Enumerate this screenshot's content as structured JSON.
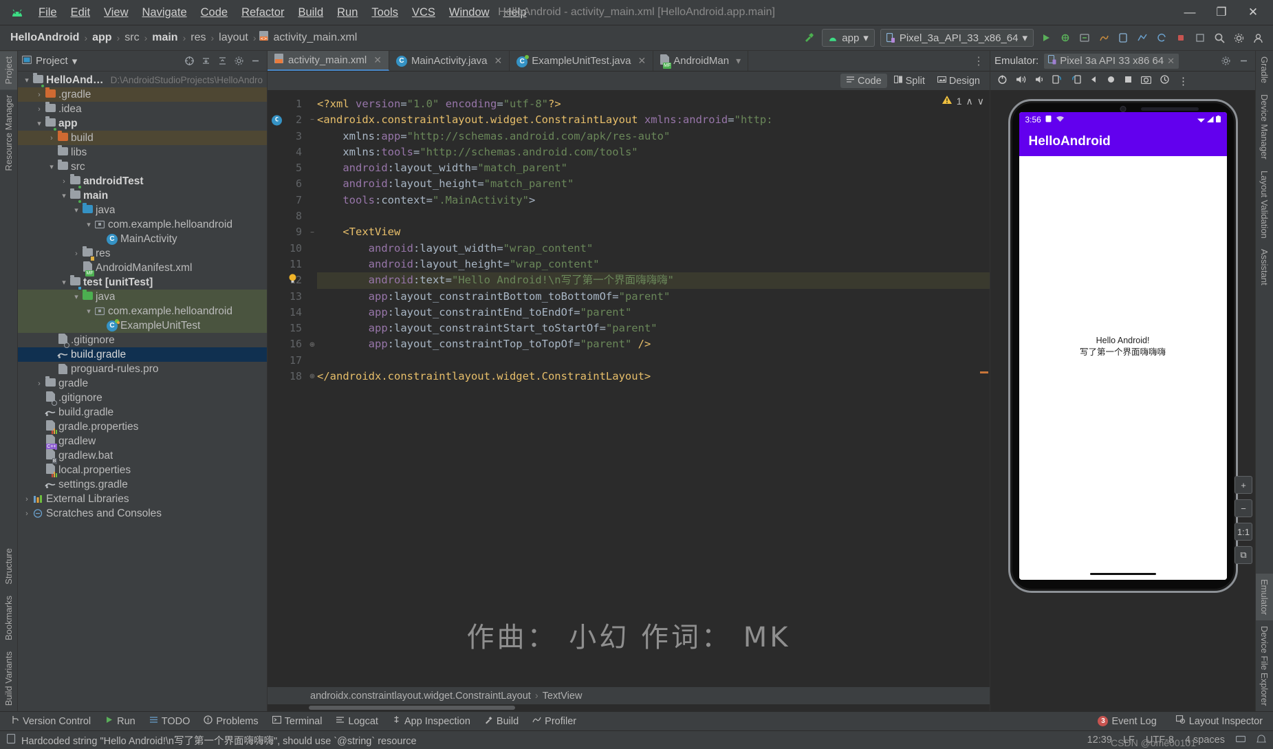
{
  "window": {
    "title": "HelloAndroid - activity_main.xml [HelloAndroid.app.main]",
    "minimize": "—",
    "maximize": "❐",
    "close": "✕"
  },
  "menubar": [
    {
      "label": "File"
    },
    {
      "label": "Edit"
    },
    {
      "label": "View"
    },
    {
      "label": "Navigate"
    },
    {
      "label": "Code"
    },
    {
      "label": "Refactor"
    },
    {
      "label": "Build"
    },
    {
      "label": "Run"
    },
    {
      "label": "Tools"
    },
    {
      "label": "VCS"
    },
    {
      "label": "Window"
    },
    {
      "label": "Help"
    }
  ],
  "breadcrumb": {
    "items": [
      "HelloAndroid",
      "app",
      "src",
      "main",
      "res",
      "layout",
      "activity_main.xml"
    ],
    "separator": "›"
  },
  "toolbar": {
    "run_config": "app",
    "device": "Pixel_3a_API_33_x86_64",
    "dropdown_caret": "▾"
  },
  "left_rail": {
    "top": [
      "Project",
      "Resource Manager"
    ],
    "bottom": [
      "Structure",
      "Bookmarks",
      "Build Variants"
    ]
  },
  "right_rail": {
    "items": [
      "Gradle",
      "Device Manager",
      "Layout Validation",
      "Assistant",
      "Emulator",
      "Device File Explorer"
    ]
  },
  "project_panel": {
    "title": "Project",
    "caret": "▾",
    "tree": [
      {
        "indent": 0,
        "arrow": "∨",
        "icon": "module-folder",
        "label": "HelloAndroid",
        "bold": true,
        "path": "D:\\AndroidStudioProjects\\HelloAndro",
        "highlight": ""
      },
      {
        "indent": 1,
        "arrow": "›",
        "icon": "folder-orange",
        "label": ".gradle",
        "bold": false,
        "path": "",
        "highlight": "brown"
      },
      {
        "indent": 1,
        "arrow": "›",
        "icon": "folder-grey",
        "label": ".idea",
        "bold": false,
        "path": "",
        "highlight": ""
      },
      {
        "indent": 1,
        "arrow": "∨",
        "icon": "module-folder",
        "label": "app",
        "bold": true,
        "path": "",
        "highlight": ""
      },
      {
        "indent": 2,
        "arrow": "›",
        "icon": "folder-orange",
        "label": "build",
        "bold": false,
        "path": "",
        "highlight": "brown"
      },
      {
        "indent": 2,
        "arrow": "",
        "icon": "folder-grey",
        "label": "libs",
        "bold": false,
        "path": "",
        "highlight": ""
      },
      {
        "indent": 2,
        "arrow": "∨",
        "icon": "folder-grey",
        "label": "src",
        "bold": false,
        "path": "",
        "highlight": ""
      },
      {
        "indent": 3,
        "arrow": "›",
        "icon": "module-folder",
        "label": "androidTest",
        "bold": true,
        "path": "",
        "highlight": ""
      },
      {
        "indent": 3,
        "arrow": "∨",
        "icon": "module-folder",
        "label": "main",
        "bold": true,
        "path": "",
        "highlight": ""
      },
      {
        "indent": 4,
        "arrow": "∨",
        "icon": "folder-blue",
        "label": "java",
        "bold": false,
        "path": "",
        "highlight": ""
      },
      {
        "indent": 5,
        "arrow": "∨",
        "icon": "package",
        "label": "com.example.helloandroid",
        "bold": false,
        "path": "",
        "highlight": ""
      },
      {
        "indent": 6,
        "arrow": "",
        "icon": "class",
        "label": "MainActivity",
        "bold": false,
        "path": "",
        "highlight": ""
      },
      {
        "indent": 4,
        "arrow": "›",
        "icon": "folder-res",
        "label": "res",
        "bold": false,
        "path": "",
        "highlight": ""
      },
      {
        "indent": 4,
        "arrow": "",
        "icon": "manifest",
        "label": "AndroidManifest.xml",
        "bold": false,
        "path": "",
        "highlight": ""
      },
      {
        "indent": 3,
        "arrow": "∨",
        "icon": "module-folder-b",
        "label": "test [unitTest]",
        "bold": true,
        "path": "",
        "highlight": ""
      },
      {
        "indent": 4,
        "arrow": "∨",
        "icon": "folder-green",
        "label": "java",
        "bold": false,
        "path": "",
        "highlight": "green"
      },
      {
        "indent": 5,
        "arrow": "∨",
        "icon": "package",
        "label": "com.example.helloandroid",
        "bold": false,
        "path": "",
        "highlight": "green"
      },
      {
        "indent": 6,
        "arrow": "",
        "icon": "class-test",
        "label": "ExampleUnitTest",
        "bold": false,
        "path": "",
        "highlight": "green"
      },
      {
        "indent": 2,
        "arrow": "",
        "icon": "gitignore",
        "label": ".gitignore",
        "bold": false,
        "path": "",
        "highlight": ""
      },
      {
        "indent": 2,
        "arrow": "",
        "icon": "gradle-file",
        "label": "build.gradle",
        "bold": false,
        "path": "",
        "highlight": "sel"
      },
      {
        "indent": 2,
        "arrow": "",
        "icon": "file",
        "label": "proguard-rules.pro",
        "bold": false,
        "path": "",
        "highlight": ""
      },
      {
        "indent": 1,
        "arrow": "›",
        "icon": "folder-grey",
        "label": "gradle",
        "bold": false,
        "path": "",
        "highlight": ""
      },
      {
        "indent": 1,
        "arrow": "",
        "icon": "gitignore",
        "label": ".gitignore",
        "bold": false,
        "path": "",
        "highlight": ""
      },
      {
        "indent": 1,
        "arrow": "",
        "icon": "gradle-file",
        "label": "build.gradle",
        "bold": false,
        "path": "",
        "highlight": ""
      },
      {
        "indent": 1,
        "arrow": "",
        "icon": "properties",
        "label": "gradle.properties",
        "bold": false,
        "path": "",
        "highlight": ""
      },
      {
        "indent": 1,
        "arrow": "",
        "icon": "shell",
        "label": "gradlew",
        "bold": false,
        "path": "",
        "highlight": ""
      },
      {
        "indent": 1,
        "arrow": "",
        "icon": "bat",
        "label": "gradlew.bat",
        "bold": false,
        "path": "",
        "highlight": ""
      },
      {
        "indent": 1,
        "arrow": "",
        "icon": "properties",
        "label": "local.properties",
        "bold": false,
        "path": "",
        "highlight": ""
      },
      {
        "indent": 1,
        "arrow": "",
        "icon": "gradle-file",
        "label": "settings.gradle",
        "bold": false,
        "path": "",
        "highlight": ""
      },
      {
        "indent": 0,
        "arrow": "›",
        "icon": "libs",
        "label": "External Libraries",
        "bold": false,
        "path": "",
        "highlight": ""
      },
      {
        "indent": 0,
        "arrow": "›",
        "icon": "scratch",
        "label": "Scratches and Consoles",
        "bold": false,
        "path": "",
        "highlight": ""
      }
    ]
  },
  "editor": {
    "tabs": [
      {
        "label": "activity_main.xml",
        "icon": "xml-layout-icon",
        "active": true,
        "close": "✕"
      },
      {
        "label": "MainActivity.java",
        "icon": "class-icon",
        "active": false,
        "close": "✕"
      },
      {
        "label": "ExampleUnitTest.java",
        "icon": "class-test-icon",
        "active": false,
        "close": "✕"
      },
      {
        "label": "AndroidMan",
        "icon": "manifest-icon",
        "active": false,
        "close": "▾"
      }
    ],
    "tab_overflow": "⋮",
    "modes": [
      {
        "label": "Code",
        "active": true
      },
      {
        "label": "Split",
        "active": false
      },
      {
        "label": "Design",
        "active": false
      }
    ],
    "warning_count": "1",
    "warning_up": "∧",
    "warning_down": "∨",
    "breadcrumb": [
      "androidx.constraintlayout.widget.ConstraintLayout",
      "TextView"
    ],
    "breadcrumb_sep": "›",
    "lines": [
      {
        "n": "1",
        "fold": "",
        "mark": "",
        "hl": false,
        "tokens": [
          {
            "t": "<?xml ",
            "c": "pi"
          },
          {
            "t": "version",
            "c": "attr"
          },
          {
            "t": "=",
            "c": "eq"
          },
          {
            "t": "\"1.0\"",
            "c": "str"
          },
          {
            "t": " ",
            "c": "plain"
          },
          {
            "t": "encoding",
            "c": "attr"
          },
          {
            "t": "=",
            "c": "eq"
          },
          {
            "t": "\"utf-8\"",
            "c": "str"
          },
          {
            "t": "?>",
            "c": "pi"
          }
        ]
      },
      {
        "n": "2",
        "fold": "−",
        "mark": "class-gutter",
        "hl": false,
        "tokens": [
          {
            "t": "<androidx.constraintlayout.widget.ConstraintLayout",
            "c": "tag"
          },
          {
            "t": " ",
            "c": "plain"
          },
          {
            "t": "xmlns:android",
            "c": "attr"
          },
          {
            "t": "=",
            "c": "eq"
          },
          {
            "t": "\"http:",
            "c": "str"
          }
        ]
      },
      {
        "n": "3",
        "fold": "",
        "mark": "",
        "hl": false,
        "tokens": [
          {
            "t": "    ",
            "c": "plain"
          },
          {
            "t": "xmlns:",
            "c": "plain"
          },
          {
            "t": "app",
            "c": "attr"
          },
          {
            "t": "=",
            "c": "eq"
          },
          {
            "t": "\"http://schemas.android.com/apk/res-auto\"",
            "c": "str"
          }
        ]
      },
      {
        "n": "4",
        "fold": "",
        "mark": "",
        "hl": false,
        "tokens": [
          {
            "t": "    ",
            "c": "plain"
          },
          {
            "t": "xmlns:",
            "c": "plain"
          },
          {
            "t": "tools",
            "c": "attr"
          },
          {
            "t": "=",
            "c": "eq"
          },
          {
            "t": "\"http://schemas.android.com/tools\"",
            "c": "str"
          }
        ]
      },
      {
        "n": "5",
        "fold": "",
        "mark": "",
        "hl": false,
        "tokens": [
          {
            "t": "    ",
            "c": "plain"
          },
          {
            "t": "android",
            "c": "attr"
          },
          {
            "t": ":layout_width",
            "c": "plain"
          },
          {
            "t": "=",
            "c": "eq"
          },
          {
            "t": "\"match_parent\"",
            "c": "str"
          }
        ]
      },
      {
        "n": "6",
        "fold": "",
        "mark": "",
        "hl": false,
        "tokens": [
          {
            "t": "    ",
            "c": "plain"
          },
          {
            "t": "android",
            "c": "attr"
          },
          {
            "t": ":layout_height",
            "c": "plain"
          },
          {
            "t": "=",
            "c": "eq"
          },
          {
            "t": "\"match_parent\"",
            "c": "str"
          }
        ]
      },
      {
        "n": "7",
        "fold": "",
        "mark": "",
        "hl": false,
        "tokens": [
          {
            "t": "    ",
            "c": "plain"
          },
          {
            "t": "tools",
            "c": "attr"
          },
          {
            "t": ":context",
            "c": "plain"
          },
          {
            "t": "=",
            "c": "eq"
          },
          {
            "t": "\".MainActivity\"",
            "c": "str"
          },
          {
            "t": ">",
            "c": "punc"
          }
        ]
      },
      {
        "n": "8",
        "fold": "",
        "mark": "",
        "hl": false,
        "tokens": []
      },
      {
        "n": "9",
        "fold": "−",
        "mark": "",
        "hl": false,
        "tokens": [
          {
            "t": "    ",
            "c": "plain"
          },
          {
            "t": "<TextView",
            "c": "tag"
          }
        ]
      },
      {
        "n": "10",
        "fold": "",
        "mark": "",
        "hl": false,
        "tokens": [
          {
            "t": "        ",
            "c": "plain"
          },
          {
            "t": "android",
            "c": "attr"
          },
          {
            "t": ":layout_width",
            "c": "plain"
          },
          {
            "t": "=",
            "c": "eq"
          },
          {
            "t": "\"wrap_content\"",
            "c": "str"
          }
        ]
      },
      {
        "n": "11",
        "fold": "",
        "mark": "",
        "hl": false,
        "tokens": [
          {
            "t": "        ",
            "c": "plain"
          },
          {
            "t": "android",
            "c": "attr"
          },
          {
            "t": ":layout_height",
            "c": "plain"
          },
          {
            "t": "=",
            "c": "eq"
          },
          {
            "t": "\"wrap_content\"",
            "c": "str"
          }
        ]
      },
      {
        "n": "12",
        "fold": "",
        "mark": "bulb",
        "hl": true,
        "tokens": [
          {
            "t": "        ",
            "c": "plain"
          },
          {
            "t": "android",
            "c": "attr"
          },
          {
            "t": ":text",
            "c": "plain"
          },
          {
            "t": "=",
            "c": "eq"
          },
          {
            "t": "\"Hello Android!\\n写了第一个界面嗨嗨嗨\"",
            "c": "str"
          }
        ]
      },
      {
        "n": "13",
        "fold": "",
        "mark": "",
        "hl": false,
        "tokens": [
          {
            "t": "        ",
            "c": "plain"
          },
          {
            "t": "app",
            "c": "attr"
          },
          {
            "t": ":layout_constraintBottom_toBottomOf",
            "c": "plain"
          },
          {
            "t": "=",
            "c": "eq"
          },
          {
            "t": "\"parent\"",
            "c": "str"
          }
        ]
      },
      {
        "n": "14",
        "fold": "",
        "mark": "",
        "hl": false,
        "tokens": [
          {
            "t": "        ",
            "c": "plain"
          },
          {
            "t": "app",
            "c": "attr"
          },
          {
            "t": ":layout_constraintEnd_toEndOf",
            "c": "plain"
          },
          {
            "t": "=",
            "c": "eq"
          },
          {
            "t": "\"parent\"",
            "c": "str"
          }
        ]
      },
      {
        "n": "15",
        "fold": "",
        "mark": "",
        "hl": false,
        "tokens": [
          {
            "t": "        ",
            "c": "plain"
          },
          {
            "t": "app",
            "c": "attr"
          },
          {
            "t": ":layout_constraintStart_toStartOf",
            "c": "plain"
          },
          {
            "t": "=",
            "c": "eq"
          },
          {
            "t": "\"parent\"",
            "c": "str"
          }
        ]
      },
      {
        "n": "16",
        "fold": "⊕",
        "mark": "",
        "hl": false,
        "tokens": [
          {
            "t": "        ",
            "c": "plain"
          },
          {
            "t": "app",
            "c": "attr"
          },
          {
            "t": ":layout_constraintTop_toTopOf",
            "c": "plain"
          },
          {
            "t": "=",
            "c": "eq"
          },
          {
            "t": "\"parent\"",
            "c": "str"
          },
          {
            "t": " />",
            "c": "tag"
          }
        ]
      },
      {
        "n": "17",
        "fold": "",
        "mark": "",
        "hl": false,
        "tokens": []
      },
      {
        "n": "18",
        "fold": "⊕",
        "mark": "",
        "hl": false,
        "tokens": [
          {
            "t": "</androidx.constraintlayout.widget.ConstraintLayout>",
            "c": "tag"
          }
        ]
      }
    ]
  },
  "watermark": {
    "overlay": "作曲： 小幻  作词： MK",
    "csdn": "CSDN @ome00101"
  },
  "emulator": {
    "label": "Emulator:",
    "tab": "Pixel 3a API 33 x86 64",
    "tab_close": "✕",
    "settings_icon": "gear-icon",
    "minimize_icon": "minimize-icon",
    "controls": [
      "power-icon",
      "volume-up-icon",
      "volume-down-icon",
      "rotate-left-icon",
      "rotate-right-icon",
      "back-icon",
      "home-icon",
      "overview-icon",
      "screenshot-icon",
      "history-icon",
      "more-icon"
    ],
    "side_buttons": [
      "+",
      "−",
      "1:1",
      "⧉"
    ],
    "device": {
      "status_time": "3:56",
      "status_icons": [
        "battery-saver-icon",
        "wifi-icon"
      ],
      "status_right_icons": [
        "signal-icon",
        "wifi-icon",
        "battery-icon"
      ],
      "app_title": "HelloAndroid",
      "body_text": "Hello Android!\n写了第一个界面嗨嗨嗨"
    }
  },
  "bottom_tools": {
    "left": [
      {
        "label": "Version Control",
        "icon": "branch-icon"
      },
      {
        "label": "Run",
        "icon": "run-icon"
      },
      {
        "label": "TODO",
        "icon": "list-icon"
      },
      {
        "label": "Problems",
        "icon": "warning-icon"
      },
      {
        "label": "Terminal",
        "icon": "terminal-icon"
      },
      {
        "label": "Logcat",
        "icon": "logcat-icon"
      },
      {
        "label": "App Inspection",
        "icon": "inspect-icon"
      },
      {
        "label": "Build",
        "icon": "hammer-icon"
      },
      {
        "label": "Profiler",
        "icon": "profiler-icon"
      }
    ],
    "right": [
      {
        "label": "Event Log",
        "icon": "event-icon",
        "badge": "3"
      },
      {
        "label": "Layout Inspector",
        "icon": "layout-inspector-icon",
        "badge": ""
      }
    ]
  },
  "statusline": {
    "message": "Hardcoded string \"Hello Android!\\n写了第一个界面嗨嗨嗨\", should use `@string` resource",
    "position": "12:39",
    "line_sep": "LF",
    "encoding": "UTF-8",
    "indent": "4 spaces"
  },
  "colors": {
    "accent_purple": "#6200ee",
    "selection_blue": "#103050",
    "warn_yellow": "#f0c040",
    "string_green": "#6a8759",
    "tag_yellow": "#e8bf6a",
    "attr_purple": "#9876aa"
  }
}
